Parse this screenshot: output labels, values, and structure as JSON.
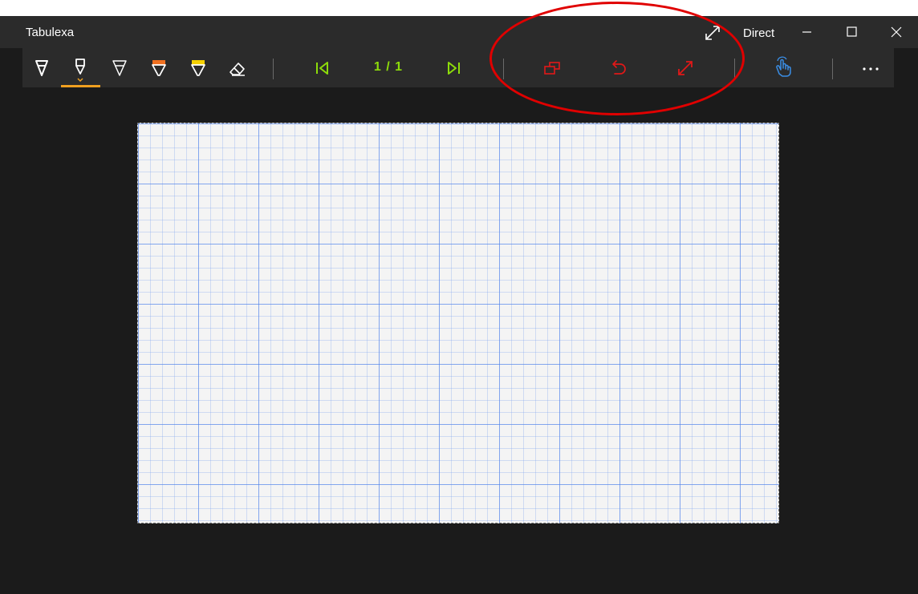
{
  "window": {
    "title": "Tabulexa",
    "mode_label": "Direct"
  },
  "toolbar": {
    "page_counter": "1 / 1",
    "active_tool": "pen-2",
    "colors": {
      "pen": "#ffffffff",
      "navigation": "#8ddc0a",
      "edit_actions": "#e01818",
      "touch_mode": "#3a8ee6",
      "orange_highlighter": "#f07020",
      "yellow_highlighter": "#f5d000",
      "active_underline": "#f0a020"
    },
    "tools": [
      {
        "icon": "pen-icon"
      },
      {
        "icon": "pen-icon",
        "active": true
      },
      {
        "icon": "pen-icon"
      },
      {
        "icon": "highlighter-icon",
        "color": "orange"
      },
      {
        "icon": "highlighter-icon",
        "color": "yellow"
      },
      {
        "icon": "eraser-icon"
      }
    ],
    "actions": [
      {
        "icon": "first-page-icon"
      },
      {
        "icon": "last-page-icon"
      },
      {
        "icon": "duplicate-page-icon"
      },
      {
        "icon": "undo-icon"
      },
      {
        "icon": "resize-icon"
      },
      {
        "icon": "touch-mode-icon"
      },
      {
        "icon": "more-icon"
      }
    ]
  },
  "canvas": {
    "background": "grid-paper",
    "grid_color": "#5082eb"
  },
  "annotation": {
    "type": "ellipse",
    "color": "#e00000"
  }
}
